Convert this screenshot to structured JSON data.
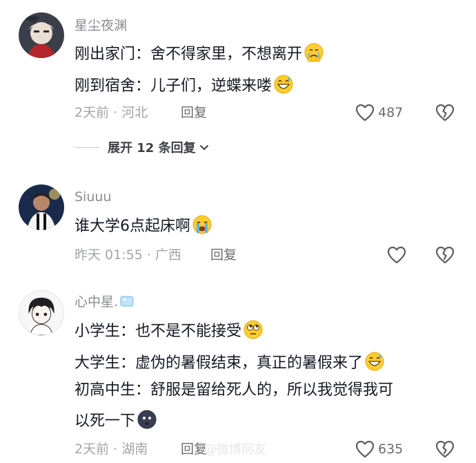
{
  "comments": [
    {
      "username": "星尘夜渊",
      "lines": [
        "刚出家门：舍不得家里，不想离开",
        "刚到宿舍：儿子们，逆蝶来喽"
      ],
      "meta": "2天前 · 河北",
      "reply_label": "回复",
      "like_count": "487",
      "avatar_icon": "anime-character-avatar-icon",
      "line_emojis": [
        "crying-emoji-icon",
        "grinning-sweat-emoji-icon"
      ]
    },
    {
      "username": "Siuuu",
      "lines": [
        "谁大学6点起床啊"
      ],
      "meta": "昨天 01:55 · 广西",
      "reply_label": "回复",
      "like_count": "",
      "avatar_icon": "football-player-avatar-icon",
      "line_emojis": [
        "loudly-crying-emoji-icon"
      ]
    },
    {
      "username": "心中星.",
      "username_badge": "ice-cube-icon",
      "lines": [
        "小学生：也不是不能接受",
        "大学生：虚伪的暑假结束，真正的暑假来了",
        "初高中生：舒服是留给死人的，所以我觉得我可",
        "以死一下"
      ],
      "meta": "2天前 · 湖南",
      "reply_label": "回复",
      "like_count": "635",
      "avatar_icon": "anime-boy-avatar-icon",
      "line_emojis": [
        "eye-roll-emoji-icon",
        "grinning-sweat-emoji-icon",
        "",
        "dark-face-emoji-icon"
      ]
    }
  ],
  "expand": {
    "label": "展开 12 条回复",
    "icon": "chevron-down-icon"
  },
  "watermark": "@微博网友",
  "colors": {
    "text": "#161823",
    "secondary": "#a3a4a9",
    "username": "#8a8b91"
  }
}
